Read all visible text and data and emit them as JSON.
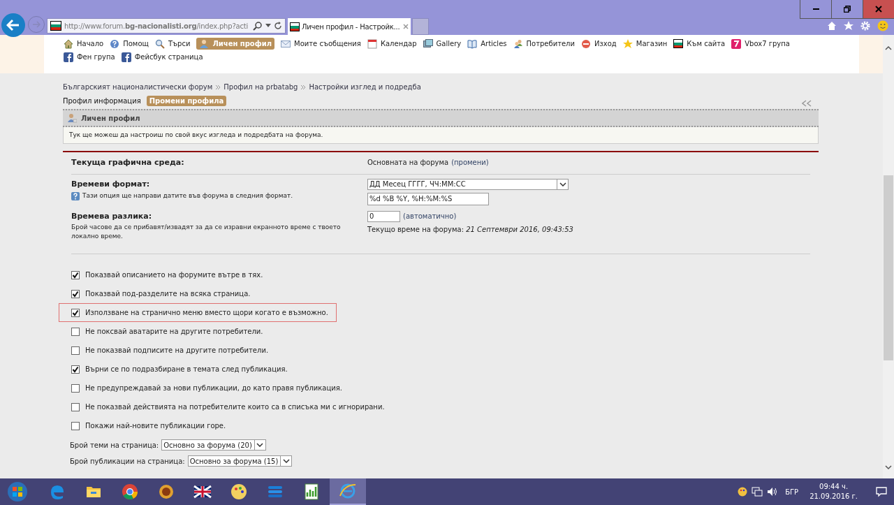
{
  "browser": {
    "url": "http://www.forum.**bg-nacionalisti.org**/index.php?acti",
    "tabs": [
      {
        "title": "Личен профил - Настройк...",
        "selected": true
      }
    ]
  },
  "nav": {
    "items": [
      {
        "label": "Начало",
        "kind": "home",
        "selected": false
      },
      {
        "label": "Помощ",
        "kind": "help",
        "selected": false
      },
      {
        "label": "Търси",
        "kind": "search",
        "selected": false
      },
      {
        "label": "Личен профил",
        "kind": "user",
        "selected": true
      },
      {
        "label": "Моите съобщения",
        "kind": "mail",
        "selected": false
      },
      {
        "label": "Календар",
        "kind": "calendar",
        "selected": false
      },
      {
        "label": "Gallery",
        "kind": "gallery",
        "selected": false
      },
      {
        "label": "Articles",
        "kind": "book",
        "selected": false
      },
      {
        "label": "Потребители",
        "kind": "users",
        "selected": false
      },
      {
        "label": "Изход",
        "kind": "exit",
        "selected": false
      },
      {
        "label": "Магазин",
        "kind": "star",
        "selected": false
      },
      {
        "label": "Към сайта",
        "kind": "flag",
        "selected": false
      },
      {
        "label": "Vbox7 група",
        "kind": "vbox",
        "selected": false
      },
      {
        "label": "Фен група",
        "kind": "facebook",
        "selected": false
      },
      {
        "label": "Фейсбук страница",
        "kind": "facebook",
        "selected": false
      }
    ]
  },
  "breadcrumb": [
    "Българският националистически форум",
    "Профил на prbatabg",
    "Настройки изглед и подредба"
  ],
  "profile_tabs": [
    {
      "label": "Профил информация",
      "selected": false
    },
    {
      "label": "Промени профила",
      "selected": true
    }
  ],
  "section": {
    "title": "Личен профил",
    "description": "Тук ще можеш да настроиш по свой вкус изгледа и подредбата на форума."
  },
  "theme": {
    "label": "Текуща графична среда:",
    "value": "Основната на форума",
    "link": "(промени)"
  },
  "time_format": {
    "label": "Времеви формат:",
    "help": "Тази опция ще направи датите във форума в следния формат.",
    "select": "ДД Месец ГГГГ, ЧЧ:ММ:СС",
    "value": "%d %B %Y, %H:%M:%S"
  },
  "time_offset": {
    "label": "Времева разлика:",
    "help": "Брой часове да се прибавят/извадят за да се изравни екранното време с твоето локално време.",
    "value": "0",
    "link": "(автоматично)",
    "current_label": "Текущо време на форума:",
    "current_value": "21 Септември 2016, 09:43:53"
  },
  "options": [
    {
      "label": "Показвай описанието на форумите вътре в тях.",
      "checked": true,
      "highlighted": false
    },
    {
      "label": "Показвай под-разделите на всяка страница.",
      "checked": true,
      "highlighted": false
    },
    {
      "label": "Използване на странично меню вместо щори когато е възможно.",
      "checked": true,
      "highlighted": true
    },
    {
      "label": "Не поксвай аватарите на другите потребители.",
      "checked": false,
      "highlighted": false
    },
    {
      "label": "Не показвай подписите на другите потребители.",
      "checked": false,
      "highlighted": false
    },
    {
      "label": "Върни се по подразбиране в темата след публикация.",
      "checked": true,
      "highlighted": false
    },
    {
      "label": "Не предупреждавай за нови публикации, до като правя публикация.",
      "checked": false,
      "highlighted": false
    },
    {
      "label": "Не показвай действията на потребителите които са в списъка ми с игнорирани.",
      "checked": false,
      "highlighted": false
    },
    {
      "label": "Покажи най-новите публикации горе.",
      "checked": false,
      "highlighted": false
    }
  ],
  "selects": [
    {
      "label": "Брой теми на страница:",
      "value": "Основно за форума (20)"
    },
    {
      "label": "Брой публикации на страница:",
      "value": "Основно за форума (15)"
    }
  ],
  "taskbar": {
    "apps": [
      {
        "kind": "edge",
        "selected": false
      },
      {
        "kind": "folder",
        "selected": false
      },
      {
        "kind": "chrome",
        "selected": false
      },
      {
        "kind": "sun",
        "selected": false
      },
      {
        "kind": "ukflag",
        "selected": false
      },
      {
        "kind": "palette",
        "selected": false
      },
      {
        "kind": "stack",
        "selected": false
      },
      {
        "kind": "chart",
        "selected": false
      },
      {
        "kind": "ie",
        "selected": true
      }
    ],
    "language": "БГР",
    "time": "09:44 ч.",
    "date": "21.09.2016 г."
  }
}
